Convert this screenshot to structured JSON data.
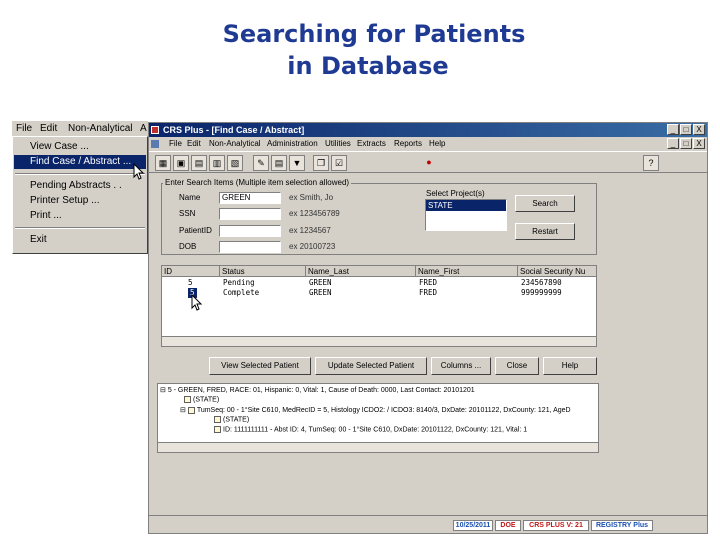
{
  "slide": {
    "title_line1": "Searching for Patients",
    "title_line2": "in Database"
  },
  "overlay_menu": {
    "bar": [
      "File",
      "Edit",
      "Non-Analytical",
      "A"
    ],
    "items": [
      "View Case ...",
      "Find Case / Abstract ...",
      "Pending Abstracts . .",
      "Printer Setup ...",
      "Print ...",
      "Exit"
    ],
    "selected_index": 1
  },
  "window": {
    "title": "CRS Plus - [Find Case / Abstract]",
    "controls": [
      "_",
      "□",
      "X"
    ],
    "menu": [
      "File",
      "Edit",
      "Non-Analytical",
      "Administration",
      "Utilities",
      "Extracts",
      "Reports",
      "Help"
    ],
    "inner_controls": [
      "_",
      "□",
      "X"
    ]
  },
  "search": {
    "group_label": "Enter Search Items (Multiple item selection allowed)",
    "fields": [
      {
        "label": "Name",
        "value": "GREEN",
        "hint": "ex Smith, Jo"
      },
      {
        "label": "SSN",
        "value": "",
        "hint": "ex 123456789"
      },
      {
        "label": "PatientID",
        "value": "",
        "hint": "ex 1234567"
      },
      {
        "label": "DOB",
        "value": "",
        "hint": "ex 20100723"
      }
    ],
    "project_label": "Select Project(s)",
    "projects": [
      "STATE"
    ],
    "search_btn": "Search",
    "restart_btn": "Restart"
  },
  "results": {
    "columns": [
      "ID",
      "Status",
      "Name_Last",
      "Name_First",
      "Social Security Nu"
    ],
    "rows": [
      [
        "5",
        "Pending",
        "GREEN",
        "FRED",
        "234567890"
      ],
      [
        "5",
        "Complete",
        "GREEN",
        "FRED",
        "999999999"
      ]
    ]
  },
  "actions": {
    "view": "View Selected Patient",
    "update": "Update Selected Patient",
    "columns": "Columns ...",
    "close": "Close",
    "help": "Help"
  },
  "tree": [
    "5 - GREEN, FRED,  RACE: 01, Hispanic: 0, Vital: 1, Cause of Death: 0000, Last Contact: 20101201",
    "(STATE)",
    "TumSeq: 00 - 1°Site C610, MedRecID = 5, Histology ICDO2: / ICDO3: 8140/3, DxDate: 20101122, DxCounty: 121, AgeD",
    "(STATE)",
    "ID: 1111111111 - Abst ID: 4, TumSeq: 00 - 1°Site C610, DxDate: 20101122, DxCounty: 121, Vital: 1"
  ],
  "status": {
    "date": "10/25/2011",
    "user": "DOE",
    "version": "CRS PLUS  V: 21",
    "product": "REGISTRY Plus"
  },
  "colors": {
    "title": "#1f3a93",
    "titlebar": "#0a246a",
    "face": "#d4d0c8",
    "selection": "#0a246a"
  }
}
